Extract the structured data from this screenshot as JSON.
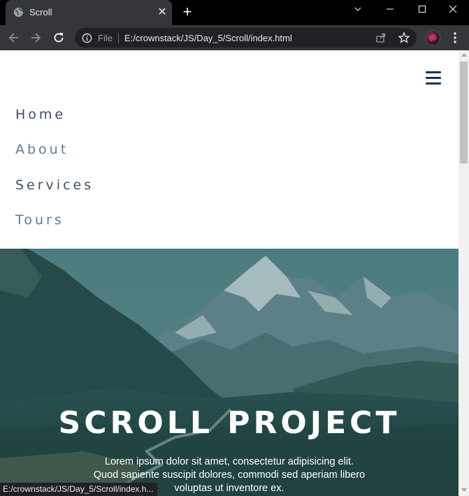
{
  "browser": {
    "tab": {
      "title": "Scroll"
    },
    "address_bar": {
      "security_label": "File",
      "url": "E:/crownstack/JS/Day_5/Scroll/index.html"
    },
    "status_url": "E:/crownstack/JS/Day_5/Scroll/index.h..."
  },
  "page": {
    "nav": {
      "links": [
        {
          "label": "Home",
          "color": "#3f4e63"
        },
        {
          "label": "About",
          "color": "#5b7b99"
        },
        {
          "label": "Services",
          "color": "#3f4e63"
        },
        {
          "label": "Tours",
          "color": "#5b7b99"
        }
      ],
      "toggle_color": "#1c3456"
    },
    "hero": {
      "title": "SCROLL PROJECT",
      "text_lines": [
        "Lorem ipsum dolor sit amet, consectetur adipisicing elit.",
        "Quod sapiente suscipit dolores, commodi sed aperiam libero",
        "voluptas ut inventore ex."
      ]
    }
  }
}
